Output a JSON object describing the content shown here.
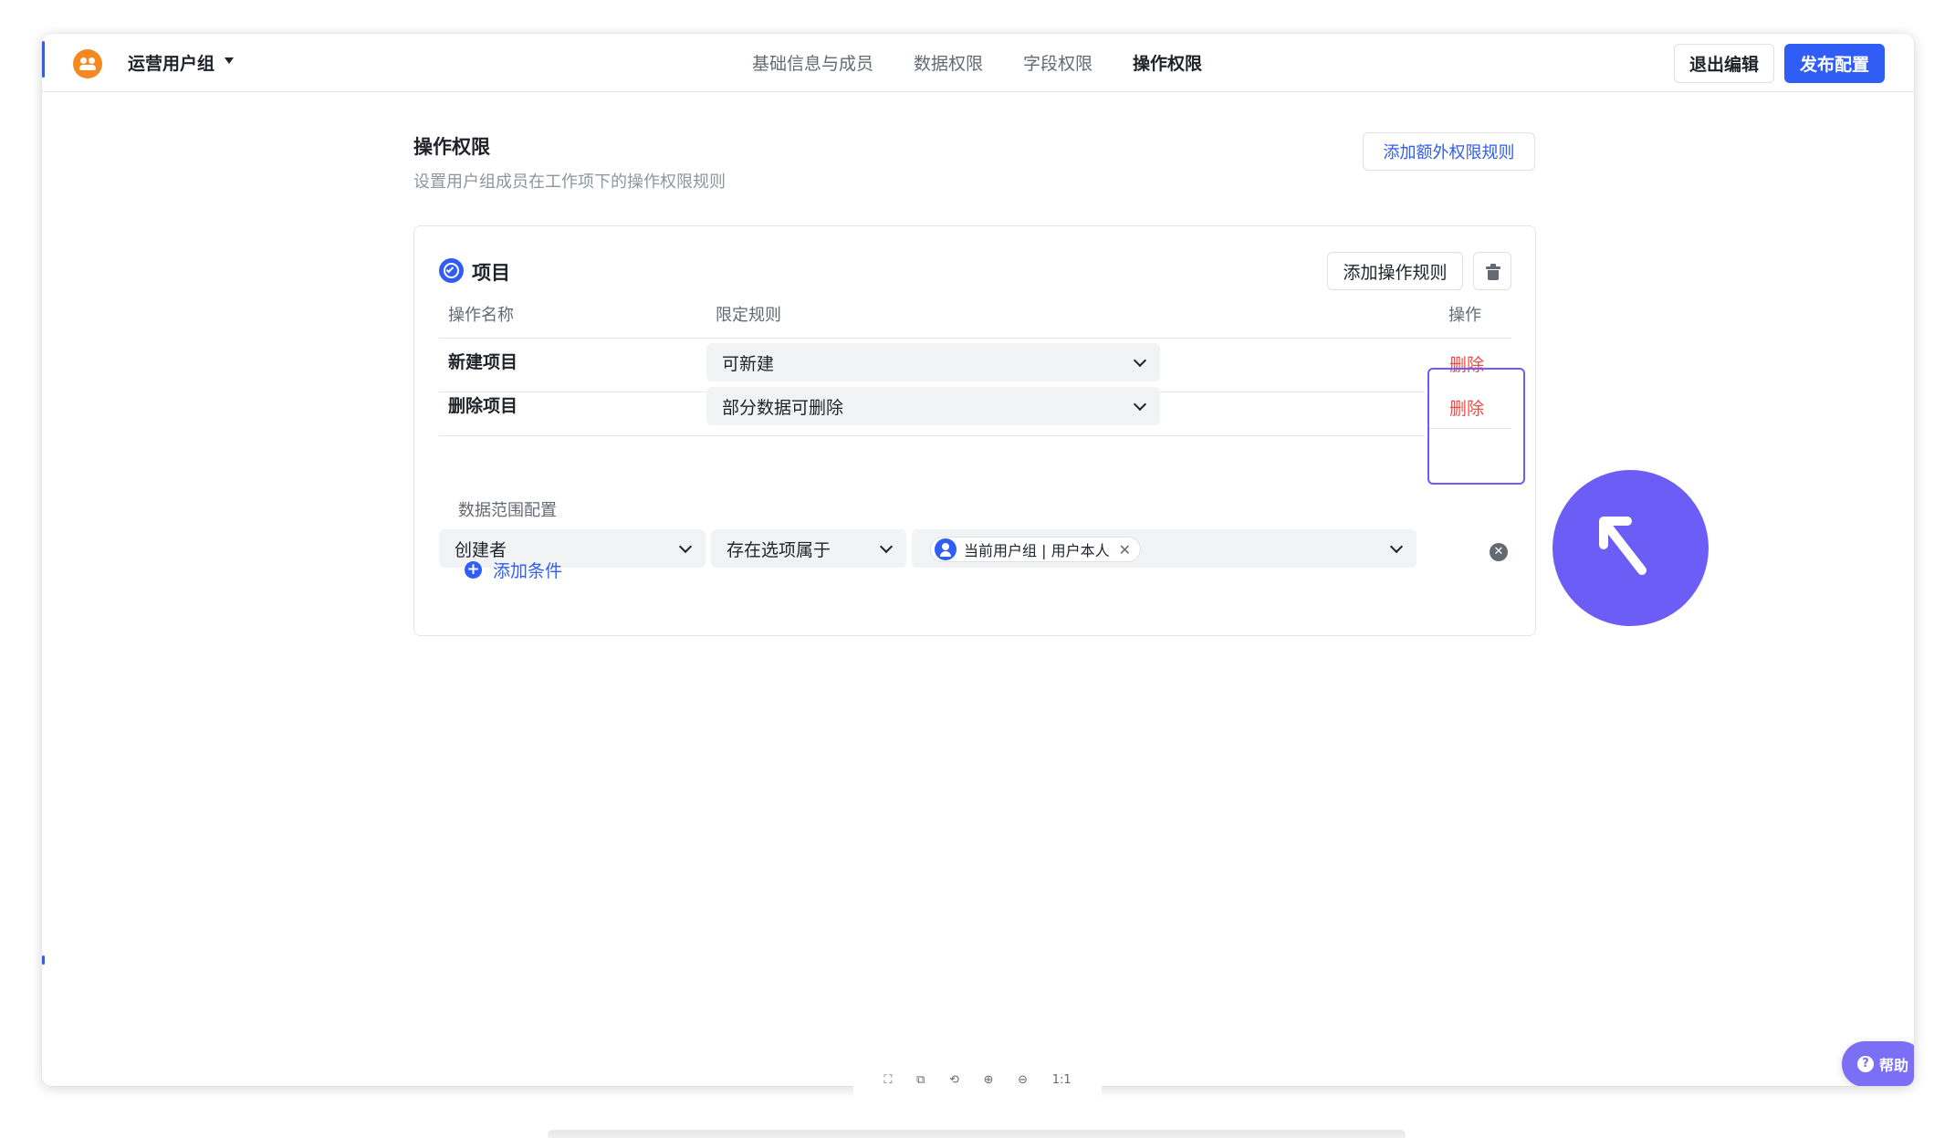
{
  "header": {
    "group_name": "运营用户组",
    "tabs": [
      {
        "label": "基础信息与成员",
        "active": false
      },
      {
        "label": "数据权限",
        "active": false
      },
      {
        "label": "字段权限",
        "active": false
      },
      {
        "label": "操作权限",
        "active": true
      }
    ],
    "exit_label": "退出编辑",
    "publish_label": "发布配置"
  },
  "section": {
    "title": "操作权限",
    "description": "设置用户组成员在工作项下的操作权限规则",
    "add_extra_label": "添加额外权限规则"
  },
  "card": {
    "title": "项目",
    "add_rule_label": "添加操作规则",
    "columns": [
      "操作名称",
      "限定规则",
      "操作"
    ],
    "rows": [
      {
        "name": "新建项目",
        "rule": "可新建",
        "action": "删除"
      },
      {
        "name": "删除项目",
        "rule": "部分数据可删除",
        "action": "删除"
      }
    ],
    "scope": {
      "label": "数据范围配置",
      "field": "创建者",
      "operator": "存在选项属于",
      "value_token": "当前用户组 | 用户本人",
      "add_condition_label": "添加条件"
    }
  },
  "help": {
    "label": "帮助"
  },
  "toolbar": {
    "items": [
      "⛶",
      "⧉",
      "⟲",
      "⊕",
      "⊖",
      "1:1"
    ]
  },
  "colors": {
    "primary": "#2f5df5",
    "danger": "#f54a45",
    "highlight": "#6b5df5",
    "group_avatar": "#f5891f"
  }
}
